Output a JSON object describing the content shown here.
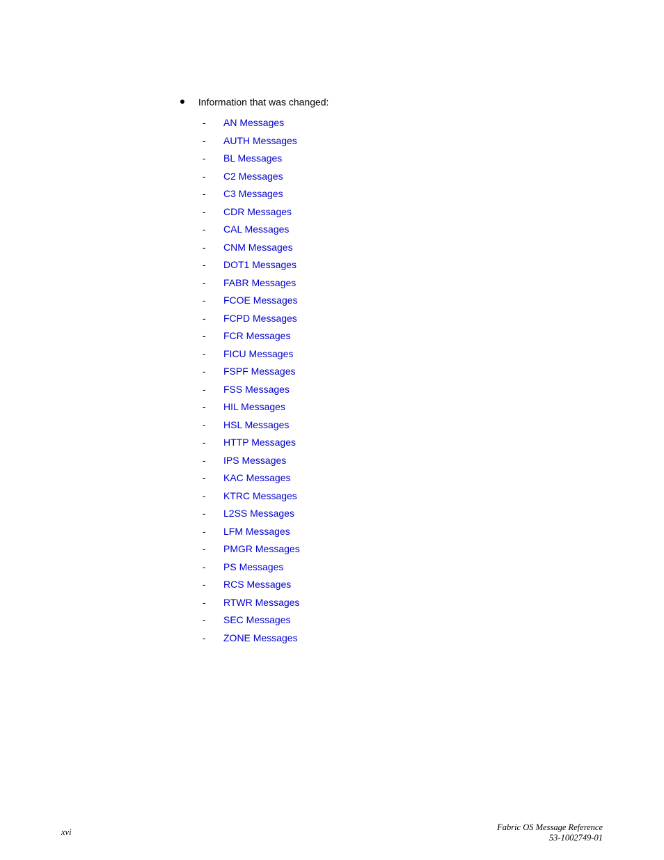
{
  "header": {
    "intro": "Information that was changed:"
  },
  "links": [
    {
      "label": "AN Messages"
    },
    {
      "label": "AUTH Messages"
    },
    {
      "label": "BL Messages"
    },
    {
      "label": "C2 Messages"
    },
    {
      "label": "C3 Messages"
    },
    {
      "label": "CDR Messages"
    },
    {
      "label": "CAL Messages"
    },
    {
      "label": "CNM Messages"
    },
    {
      "label": "DOT1 Messages"
    },
    {
      "label": "FABR Messages"
    },
    {
      "label": "FCOE Messages"
    },
    {
      "label": "FCPD Messages"
    },
    {
      "label": "FCR Messages"
    },
    {
      "label": "FICU Messages"
    },
    {
      "label": "FSPF Messages"
    },
    {
      "label": "FSS Messages"
    },
    {
      "label": "HIL Messages"
    },
    {
      "label": "HSL Messages"
    },
    {
      "label": "HTTP Messages"
    },
    {
      "label": "IPS Messages"
    },
    {
      "label": "KAC Messages"
    },
    {
      "label": "KTRC Messages"
    },
    {
      "label": "L2SS Messages"
    },
    {
      "label": "LFM Messages"
    },
    {
      "label": "PMGR Messages"
    },
    {
      "label": "PS Messages"
    },
    {
      "label": "RCS Messages"
    },
    {
      "label": "RTWR Messages"
    },
    {
      "label": "SEC Messages"
    },
    {
      "label": "ZONE Messages"
    }
  ],
  "footer": {
    "page_number": "xvi",
    "ref_line1": "Fabric OS Message Reference",
    "ref_line2": "53-1002749-01"
  }
}
